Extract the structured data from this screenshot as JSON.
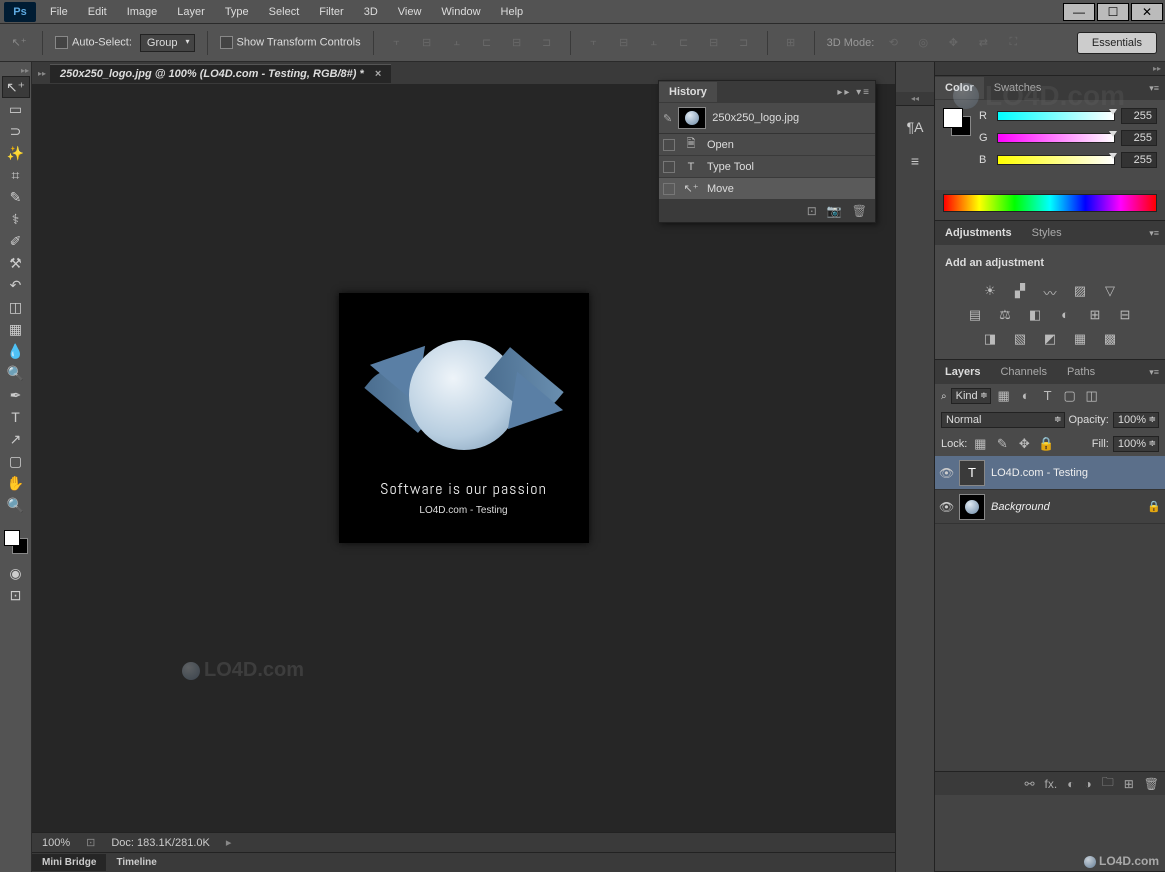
{
  "app": {
    "logo": "Ps"
  },
  "menu": [
    "File",
    "Edit",
    "Image",
    "Layer",
    "Type",
    "Select",
    "Filter",
    "3D",
    "View",
    "Window",
    "Help"
  ],
  "options": {
    "auto_select": "Auto-Select:",
    "group": "Group",
    "show_transform": "Show Transform Controls",
    "mode_label": "3D Mode:",
    "workspace": "Essentials"
  },
  "doc_tab": "250x250_logo.jpg @ 100% (LO4D.com - Testing, RGB/8#) *",
  "canvas": {
    "text1": "Software is our passion",
    "text2": "LO4D.com - Testing"
  },
  "watermark": "LO4D.com",
  "status": {
    "zoom": "100%",
    "doc_label": "Doc:",
    "doc_size": "183.1K/281.0K"
  },
  "bottom_tabs": [
    "Mini Bridge",
    "Timeline"
  ],
  "history": {
    "title": "History",
    "doc_name": "250x250_logo.jpg",
    "items": [
      {
        "icon": "🗎",
        "label": "Open"
      },
      {
        "icon": "T",
        "label": "Type Tool"
      },
      {
        "icon": "↖⁺",
        "label": "Move"
      }
    ]
  },
  "color_panel": {
    "tabs": [
      "Color",
      "Swatches"
    ],
    "channels": [
      {
        "label": "R",
        "value": "255"
      },
      {
        "label": "G",
        "value": "255"
      },
      {
        "label": "B",
        "value": "255"
      }
    ]
  },
  "adjustments": {
    "tabs": [
      "Adjustments",
      "Styles"
    ],
    "heading": "Add an adjustment"
  },
  "layers_panel": {
    "tabs": [
      "Layers",
      "Channels",
      "Paths"
    ],
    "kind_label": "Kind",
    "blend": "Normal",
    "opacity_label": "Opacity:",
    "opacity_val": "100%",
    "lock_label": "Lock:",
    "fill_label": "Fill:",
    "fill_val": "100%",
    "layers": [
      {
        "name": "LO4D.com - Testing",
        "type": "T",
        "italic": false,
        "locked": false,
        "selected": true
      },
      {
        "name": "Background",
        "type": "img",
        "italic": true,
        "locked": true,
        "selected": false
      }
    ]
  }
}
